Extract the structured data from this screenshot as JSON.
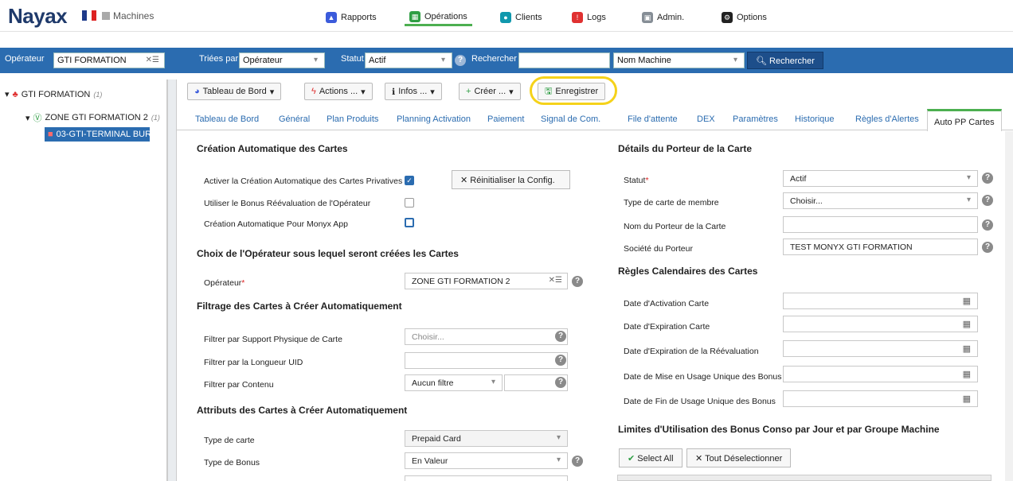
{
  "header": {
    "logo": "Nayax",
    "module": "Machines",
    "nav": [
      {
        "label": "Rapports",
        "color": "#3b5bdb"
      },
      {
        "label": "Opérations",
        "color": "#2f9e44"
      },
      {
        "label": "Clients",
        "color": "#1098ad"
      },
      {
        "label": "Logs",
        "color": "#e03131"
      },
      {
        "label": "Admin.",
        "color": "#868e96"
      },
      {
        "label": "Options",
        "color": "#222222"
      }
    ]
  },
  "filters": {
    "operator_label": "Opérateur",
    "operator_value": "GTI FORMATION",
    "sort_label": "Triées par",
    "sort_value": "Opérateur",
    "status_label": "Statut",
    "status_value": "Actif",
    "search_label": "Rechercher",
    "search_value": "",
    "search_field": "Nom Machine",
    "search_button": "Rechercher"
  },
  "tree": {
    "root": "GTI FORMATION",
    "root_count": "(1)",
    "zone": "ZONE GTI FORMATION 2",
    "zone_count": "(1)",
    "machine": "03-GTI-TERMINAL BUREAU GTI"
  },
  "toolbar": {
    "dashboard": "Tableau de Bord",
    "actions": "Actions ...",
    "infos": "Infos ...",
    "create": "Créer ...",
    "save": "Enregistrer"
  },
  "tabs": [
    "Tableau de Bord",
    "Général",
    "Plan Produits",
    "Planning Activation",
    "Paiement",
    "Signal de Com.",
    "File d'attente",
    "DEX",
    "Paramètres",
    "Historique",
    "Règles d'Alertes",
    "Auto PP Cartes"
  ],
  "left": {
    "sec_auto": "Création Automatique des Cartes",
    "activate_label": "Activer la Création Automatique des Cartes Privatives",
    "reset_button": "Réinitialiser la Config.",
    "bonus_label": "Utiliser le Bonus Réévaluation de l'Opérateur",
    "monyx_label": "Création Automatique Pour Monyx App",
    "sec_operator": "Choix de l'Opérateur sous lequel seront créées les Cartes",
    "operator_label": "Opérateur",
    "operator_value": "ZONE GTI FORMATION 2",
    "sec_filter": "Filtrage des Cartes à Créer Automatiquement",
    "support_label": "Filtrer par Support Physique de Carte",
    "support_value": "Choisir...",
    "uid_label": "Filtrer par la Longueur UID",
    "content_label": "Filtrer par Contenu",
    "content_value": "Aucun filtre",
    "sec_attr": "Attributs des Cartes à Créer Automatiquement",
    "cardtype_label": "Type de carte",
    "cardtype_value": "Prepaid Card",
    "bonustype_label": "Type de Bonus",
    "bonustype_value": "En Valeur"
  },
  "right": {
    "sec_holder": "Détails du Porteur de la Carte",
    "status_label": "Statut",
    "status_value": "Actif",
    "member_label": "Type de carte de membre",
    "member_value": "Choisir...",
    "holder_label": "Nom du Porteur de la Carte",
    "holder_value": "",
    "company_label": "Société du Porteur",
    "company_value": "TEST MONYX GTI FORMATION",
    "sec_calendar": "Règles Calendaires des Cartes",
    "date_activation": "Date d'Activation Carte",
    "date_expiration": "Date d'Expiration Carte",
    "date_exp_reeval": "Date d'Expiration de la Réévaluation",
    "date_use_start": "Date de Mise en Usage Unique des Bonus",
    "date_use_end": "Date de Fin de Usage Unique des Bonus",
    "sec_limits": "Limites d'Utilisation des Bonus Conso par Jour et par Groupe Machine",
    "select_all": "Select All",
    "deselect_all": "Tout Déselectionner"
  }
}
